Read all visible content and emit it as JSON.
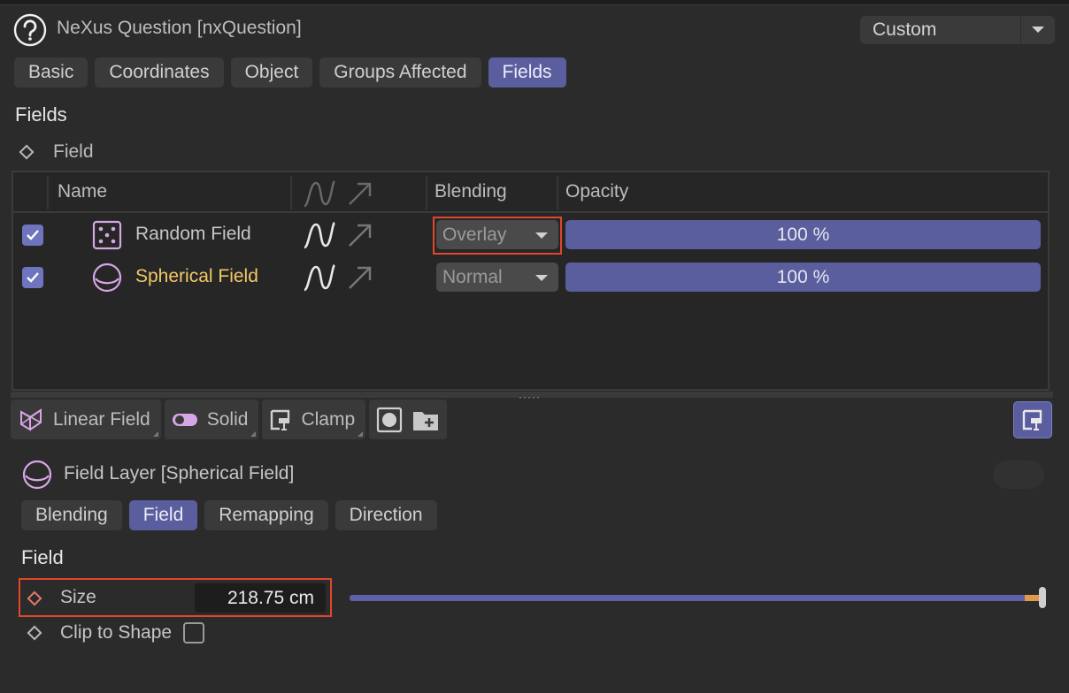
{
  "header": {
    "title": "NeXus Question [nxQuestion]",
    "preset": "Custom"
  },
  "tabs_top": [
    {
      "label": "Basic",
      "active": false
    },
    {
      "label": "Coordinates",
      "active": false
    },
    {
      "label": "Object",
      "active": false
    },
    {
      "label": "Groups Affected",
      "active": false
    },
    {
      "label": "Fields",
      "active": true
    }
  ],
  "fields_section": {
    "title": "Fields",
    "field_label": "Field"
  },
  "field_list": {
    "columns": {
      "name": "Name",
      "blending": "Blending",
      "opacity": "Opacity"
    },
    "rows": [
      {
        "enabled": true,
        "icon": "dice-icon",
        "name": "Random Field",
        "selected": false,
        "blending": "Overlay",
        "opacity": "100 %"
      },
      {
        "enabled": true,
        "icon": "sphere-icon",
        "name": "Spherical Field",
        "selected": true,
        "blending": "Normal",
        "opacity": "100 %"
      }
    ]
  },
  "toolbar": {
    "linear": "Linear Field",
    "solid": "Solid",
    "clamp": "Clamp"
  },
  "field_layer": {
    "title": "Field Layer [Spherical Field]",
    "tabs": [
      {
        "label": "Blending",
        "active": false
      },
      {
        "label": "Field",
        "active": true
      },
      {
        "label": "Remapping",
        "active": false
      },
      {
        "label": "Direction",
        "active": false
      }
    ],
    "section_title": "Field",
    "size_label": "Size",
    "size_value": "218.75 cm",
    "size_slider_fraction": 0.98,
    "clip_label": "Clip to Shape",
    "clip_checked": false
  },
  "colors": {
    "accent": "#5b5e9e",
    "highlight": "#e2462c",
    "selected_text": "#f2c866",
    "field_icon": "#d7a6e6"
  }
}
